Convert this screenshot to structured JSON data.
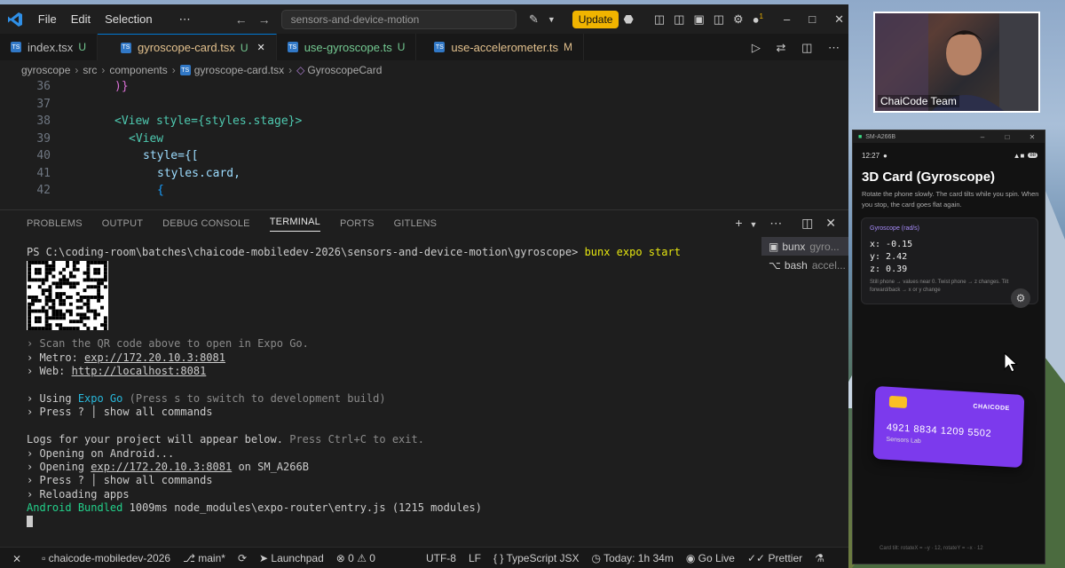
{
  "titlebar": {
    "menus": [
      "File",
      "Edit",
      "Selection"
    ],
    "more": "⋯",
    "search_text": "sensors-and-device-motion",
    "update_label": "Update",
    "badge_count": "1"
  },
  "tabs": [
    {
      "name": "index.tsx",
      "status": "U"
    },
    {
      "name": "gyroscope-card.tsx",
      "status": "U"
    },
    {
      "name": "use-gyroscope.ts",
      "status": "U"
    },
    {
      "name": "use-accelerometer.ts",
      "status": "M"
    }
  ],
  "breadcrumb": [
    "gyroscope",
    "src",
    "components",
    "gyroscope-card.tsx",
    "GyroscopeCard"
  ],
  "editor": {
    "line_numbers": [
      "36",
      "37",
      "38",
      "39",
      "40",
      "41",
      "42"
    ],
    "lines": [
      ")}",
      "",
      "<View style={styles.stage}>",
      "<View",
      "style={[",
      "styles.card,",
      "{"
    ]
  },
  "panel": {
    "tabs": [
      "PROBLEMS",
      "OUTPUT",
      "DEBUG CONSOLE",
      "TERMINAL",
      "PORTS",
      "GITLENS"
    ],
    "terminals": [
      {
        "name": "bunx",
        "detail": "gyro..."
      },
      {
        "name": "bash",
        "detail": "accel..."
      }
    ]
  },
  "terminal": {
    "prompt": "PS C:\\coding-room\\batches\\chaicode-mobiledev-2026\\sensors-and-device-motion\\gyroscope>",
    "command": "bunx expo start",
    "scan": "› Scan the QR code above to open in Expo Go.",
    "metro_label": "› Metro:",
    "metro_url": "exp://172.20.10.3:8081",
    "web_label": "› Web:",
    "web_url": "http://localhost:8081",
    "using": "› Using",
    "expo_go": "Expo Go",
    "press_s": "(Press s to switch to development build)",
    "press_q_1": "› Press ? │ show all commands",
    "logs": "Logs for your project will appear below.",
    "ctrl_c": "Press Ctrl+C to exit.",
    "opening_android": "› Opening on Android...",
    "opening_label": "› Opening",
    "opening_url": "exp://172.20.10.3:8081",
    "opening_on": "on SM_A266B",
    "press_q_2": "› Press ? │ show all commands",
    "reloading": "› Reloading apps",
    "bundled_a": "Android",
    "bundled_b": "Bundled",
    "bundled_c": "1009ms node_modules\\expo-router\\entry.js (1215 modules)"
  },
  "statusbar": {
    "remote": "⨯",
    "repo": "chaicode-mobiledev-2026",
    "branch": "main*",
    "launchpad": "Launchpad",
    "errors": "0",
    "warnings": "0",
    "encoding": "UTF-8",
    "eol": "LF",
    "language": "TypeScript JSX",
    "time": "Today: 1h 34m",
    "golive": "Go Live",
    "prettier": "Prettier"
  },
  "webcam": {
    "label": "ChaiCode Team"
  },
  "emulator": {
    "title": "SM-A266B",
    "time": "12:27",
    "battery": "88",
    "app_title": "3D Card (Gyroscope)",
    "desc": "Rotate the phone slowly. The card tilts while you spin. When you stop, the card goes flat again.",
    "gyro_title": "Gyroscope (rad/s)",
    "x": "x: -0.15",
    "y": "y: 2.42",
    "z": "z: 0.39",
    "hint": "Still phone → values near 0. Twist phone → z changes. Tilt forward/back → x or y change",
    "card_brand": "CHAICODE",
    "card_number": "4921 8834 1209 5502",
    "card_label": "Sensors Lab",
    "footer": "Card tilt: rotateX = −y · 12, rotateY = −x · 12"
  },
  "colors": {
    "accent": "#0078d4",
    "update": "#f0b400",
    "card": "#7c3aed",
    "chip": "#fbbf24",
    "gyro_title": "#a78bfa"
  }
}
